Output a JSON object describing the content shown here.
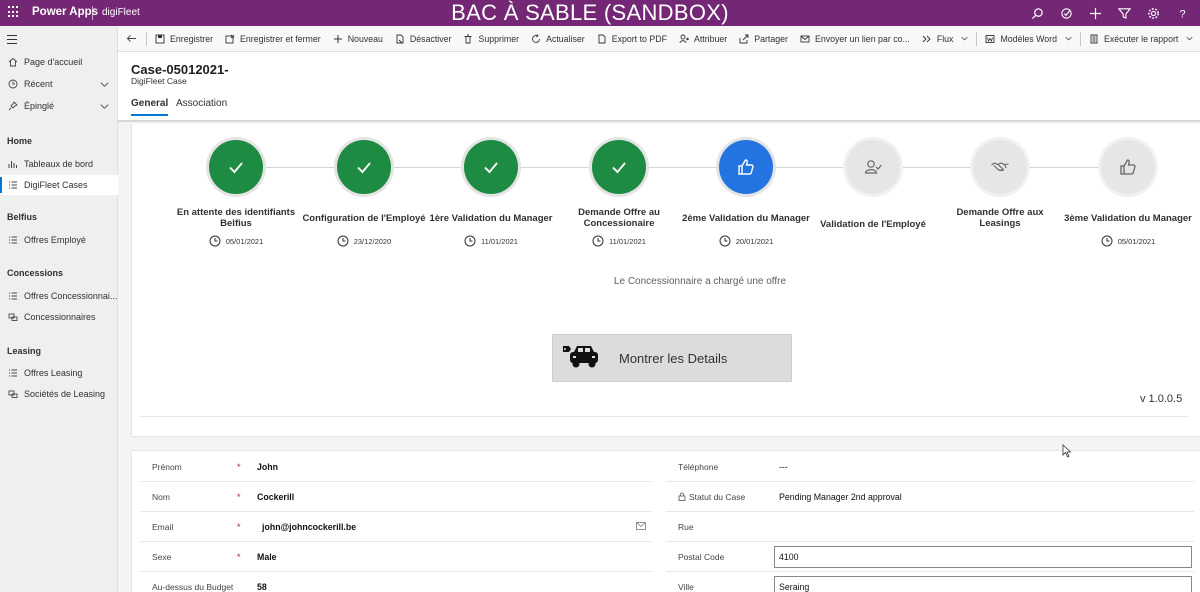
{
  "topbar": {
    "app_name": "Power Apps",
    "environment": "digiFleet",
    "title": "BAC À SABLE (SANDBOX)",
    "color": "#742774"
  },
  "sidebar": {
    "items_top": [
      {
        "label": "Page d'accueil",
        "icon": "home-icon"
      },
      {
        "label": "Récent",
        "icon": "clock-icon"
      },
      {
        "label": "Épinglé",
        "icon": "pin-icon"
      }
    ],
    "sections": [
      {
        "title": "Home",
        "items": [
          {
            "label": "Tableaux de bord",
            "icon": "dashboard-icon"
          },
          {
            "label": "DigiFleet Cases",
            "icon": "list-icon",
            "active": true
          }
        ]
      },
      {
        "title": "Belfius",
        "items": [
          {
            "label": "Offres Employé",
            "icon": "list-icon"
          }
        ]
      },
      {
        "title": "Concessions",
        "items": [
          {
            "label": "Offres Concessionnai...",
            "icon": "list-icon"
          },
          {
            "label": "Concessionnaires",
            "icon": "entity-icon"
          }
        ]
      },
      {
        "title": "Leasing",
        "items": [
          {
            "label": "Offres Leasing",
            "icon": "list-icon"
          },
          {
            "label": "Sociétés de Leasing",
            "icon": "entity-icon"
          }
        ]
      }
    ]
  },
  "commands": [
    {
      "label": "Enregistrer",
      "icon": "save-icon"
    },
    {
      "label": "Enregistrer et fermer",
      "icon": "save-close-icon"
    },
    {
      "label": "Nouveau",
      "icon": "plus-icon"
    },
    {
      "label": "Désactiver",
      "icon": "deactivate-icon"
    },
    {
      "label": "Supprimer",
      "icon": "trash-icon"
    },
    {
      "label": "Actualiser",
      "icon": "refresh-icon"
    },
    {
      "label": "Export to PDF",
      "icon": "pdf-icon"
    },
    {
      "label": "Attribuer",
      "icon": "assign-icon"
    },
    {
      "label": "Partager",
      "icon": "share-icon"
    },
    {
      "label": "Envoyer un lien par co...",
      "icon": "email-link-icon"
    },
    {
      "label": "Flux",
      "icon": "flow-icon",
      "dropdown": true
    },
    {
      "label": "Modèles Word",
      "icon": "word-icon",
      "dropdown": true
    },
    {
      "label": "Exécuter le rapport",
      "icon": "report-icon",
      "dropdown": true
    }
  ],
  "record": {
    "title": "Case-05012021-",
    "entity": "DigiFleet Case",
    "tabs": [
      "General",
      "Association"
    ]
  },
  "process": {
    "stages": [
      {
        "label": "En attente des identifiants Belfius",
        "date": "05/01/2021",
        "state": "done",
        "icon": "check-icon"
      },
      {
        "label": "Configuration de l'Employé",
        "date": "23/12/2020",
        "state": "done",
        "icon": "check-icon"
      },
      {
        "label": "1ère Validation du Manager",
        "date": "11/01/2021",
        "state": "done",
        "icon": "check-icon"
      },
      {
        "label": "Demande Offre au Concessionaire",
        "date": "11/01/2021",
        "state": "done",
        "icon": "check-icon"
      },
      {
        "label": "2ème Validation du Manager",
        "date": "20/01/2021",
        "state": "current",
        "icon": "thumbs-up-icon"
      },
      {
        "label": "Validation de l'Employé",
        "date": "",
        "state": "todo",
        "icon": "user-check-icon"
      },
      {
        "label": "Demande Offre aux Leasings",
        "date": "",
        "state": "todo",
        "icon": "handshake-icon"
      },
      {
        "label": "3ème Validation du Manager",
        "date": "05/01/2021",
        "state": "todo",
        "icon": "thumbs-up-icon"
      }
    ],
    "status_text": "Le Concessionnaire a chargé une offre",
    "details_button": "Montrer les Details",
    "version": "v 1.0.0.5",
    "colors": {
      "done": "#1e8b43",
      "current": "#2374e1",
      "todo": "#e6e6e6"
    }
  },
  "form": {
    "left": [
      {
        "label": "Prénom",
        "required": "*",
        "value": "John"
      },
      {
        "label": "Nom",
        "required": "*",
        "value": "Cockerill"
      },
      {
        "label": "Email",
        "required": "*",
        "value": "john@johncockerill.be"
      },
      {
        "label": "Sexe",
        "required": "*",
        "value": "Male"
      },
      {
        "label": "Au-dessus du Budget",
        "required": "",
        "value": "58"
      }
    ],
    "right": [
      {
        "label": "Téléphone",
        "value": "---"
      },
      {
        "label": "Statut du Case",
        "value": "Pending Manager 2nd approval"
      },
      {
        "label": "Rue",
        "value": ""
      },
      {
        "label": "Postal Code",
        "value": "4100"
      },
      {
        "label": "Ville",
        "value": "Seraing"
      }
    ]
  }
}
